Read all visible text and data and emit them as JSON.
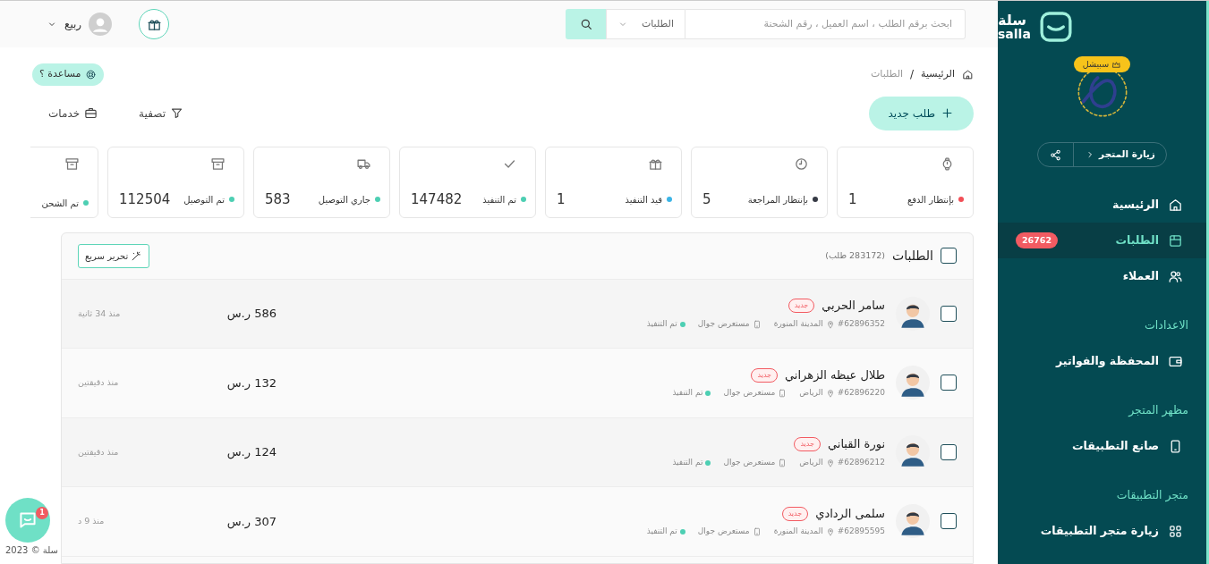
{
  "sidebar": {
    "logo_text": "سلة",
    "logo_subtext": "salla",
    "plan_badge": "سبيشل",
    "visit_store": "زيارة المتجر",
    "items": [
      {
        "kind": "link",
        "label": "الرئيسية",
        "selected": false
      },
      {
        "kind": "link",
        "label": "الطلبات",
        "selected": true,
        "badge": "26762"
      },
      {
        "kind": "link",
        "label": "العملاء",
        "selected": false
      },
      {
        "kind": "heading",
        "label": "الاعدادات"
      },
      {
        "kind": "link",
        "label": "المحفظة والفواتير",
        "selected": false
      },
      {
        "kind": "heading",
        "label": "مظهر المتجر"
      },
      {
        "kind": "link",
        "label": "صانع التطبيقات",
        "selected": false
      },
      {
        "kind": "heading",
        "label": "متجر التطبيقات"
      },
      {
        "kind": "link",
        "label": "زيارة متجر التطبيقات",
        "selected": false
      }
    ]
  },
  "topbar": {
    "search": {
      "placeholder": "ابحث برقم الطلب ، اسم العميل ، رقم الشحنة"
    },
    "scope": "الطلبات",
    "user": "ربيع"
  },
  "breadcrumb": [
    "الرئيسية",
    "الطلبات"
  ],
  "breadcrumb_separator": "/",
  "help": "مساعدة ؟",
  "new_order": "طلب جديد",
  "actions": [
    "تصفية",
    "خدمات"
  ],
  "stats": [
    {
      "label": "بإنتظار الدفع",
      "value": "1",
      "color": "#f24f57"
    },
    {
      "label": "بإنتظار المراجعة",
      "value": "5",
      "color": "#363a45"
    },
    {
      "label": "قيد التنفيذ",
      "value": "1",
      "color": "#3bb4e6"
    },
    {
      "label": "تم التنفيذ",
      "value": "147482",
      "color": "#4dcfb3"
    },
    {
      "label": "جاري التوصيل",
      "value": "583",
      "color": "#4dcfb3"
    },
    {
      "label": "تم التوصيل",
      "value": "112504",
      "color": "#4dcfb3"
    },
    {
      "label": "تم الشحن",
      "color": "#4dcfb3"
    }
  ],
  "orders": {
    "title": "الطلبات",
    "count": "(283172 طلب)",
    "checked": false,
    "quick_edit": "تحرير سريع",
    "rows": [
      {
        "name": "سامر الحربي",
        "badge": "جديد",
        "number": "#62896352",
        "city": "المدينة المنورة",
        "source": "مستعرض جوال",
        "status": "تم التنفيذ",
        "amount": "586 ر.س",
        "time": "منذ 34 ثانية",
        "checked": false
      },
      {
        "name": "طلال عيظه الزهراني",
        "badge": "جديد",
        "number": "#62896220",
        "city": "الرياض",
        "source": "مستعرض جوال",
        "status": "تم التنفيذ",
        "amount": "132 ر.س",
        "time": "منذ دقيقتين",
        "checked": false
      },
      {
        "name": "نورة القباني",
        "badge": "جديد",
        "number": "#62896212",
        "city": "الرياض",
        "source": "مستعرض جوال",
        "status": "تم التنفيذ",
        "amount": "124 ر.س",
        "time": "منذ دقيقتين",
        "checked": false
      },
      {
        "name": "سلمى الردادي",
        "badge": "جديد",
        "number": "#62895595",
        "city": "المدينة المنورة",
        "source": "مستعرض جوال",
        "status": "تم التنفيذ",
        "amount": "307 ر.س",
        "time": "منذ 9 د",
        "checked": false
      }
    ]
  },
  "chat": {
    "badge": "1"
  },
  "footer": "سلة © 2023"
}
